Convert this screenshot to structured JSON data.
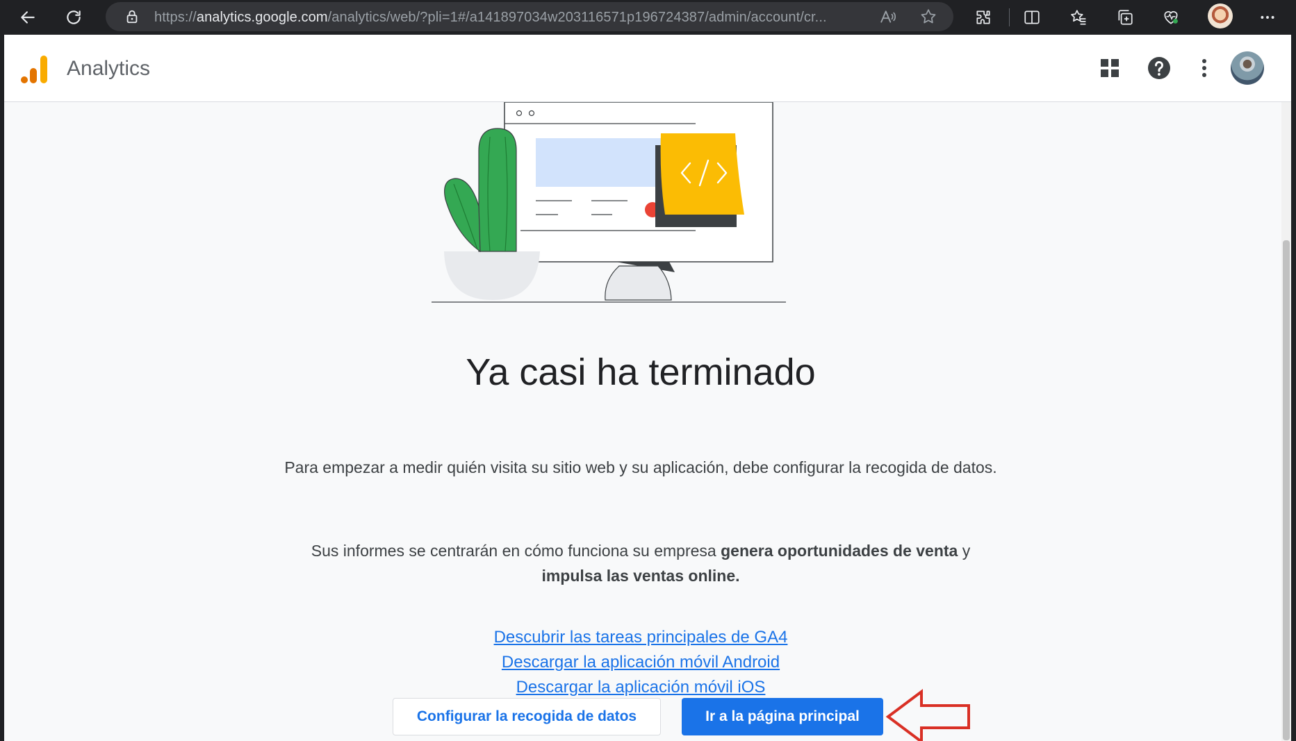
{
  "browser": {
    "url_prefix": "https://",
    "url_host": "analytics.google.com",
    "url_path": "/analytics/web/?pli=1#/a141897034w203116571p196724387/admin/account/cr..."
  },
  "header": {
    "app_title": "Analytics"
  },
  "main": {
    "heading": "Ya casi ha terminado",
    "description": "Para empezar a medir quién visita su sitio web y su aplicación, debe configurar la recogida de datos.",
    "report_text_start": "Sus informes se centrarán en cómo funciona su empresa ",
    "report_bold_1": "genera oportunidades de venta",
    "report_text_mid": " y ",
    "report_bold_2": "impulsa las ventas online.",
    "links": [
      {
        "label": "Descubrir las tareas principales de GA4"
      },
      {
        "label": "Descargar la aplicación móvil Android"
      },
      {
        "label": "Descargar la aplicación móvil iOS"
      }
    ],
    "secondary_button": "Configurar la recogida de datos",
    "primary_button": "Ir a la página principal"
  },
  "colors": {
    "accent_blue": "#1a73e8",
    "ga_orange": "#f9ab00",
    "ga_dark_orange": "#e37400",
    "annotation_red": "#d93025"
  }
}
